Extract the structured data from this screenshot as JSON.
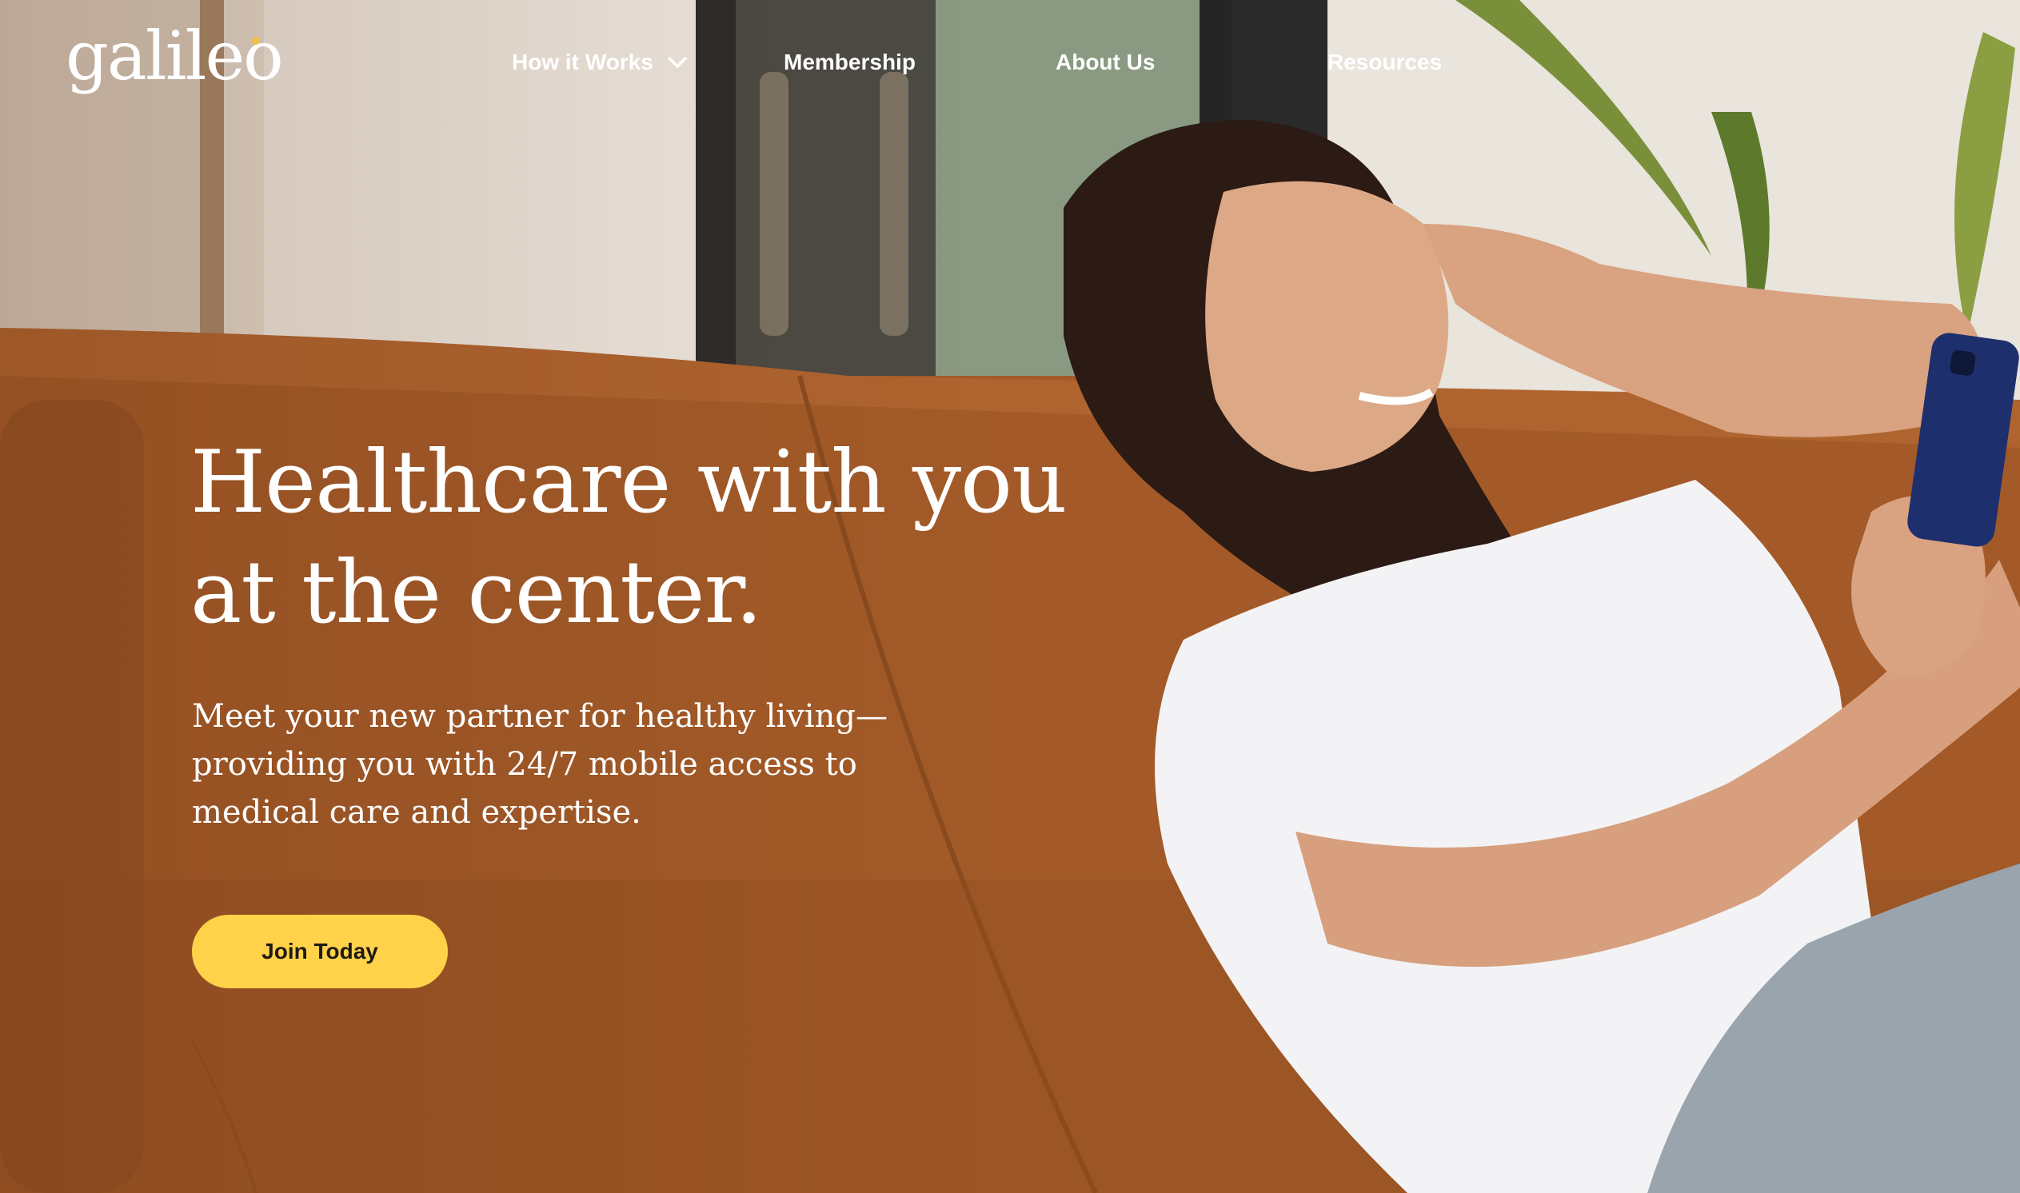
{
  "brand": {
    "logo_text": "galileo",
    "accent_color": "#f2c14b"
  },
  "nav": {
    "items": [
      {
        "label": "How it Works",
        "has_dropdown": true,
        "icon": "chevron-down-icon"
      },
      {
        "label": "Membership"
      },
      {
        "label": "About Us"
      },
      {
        "label": "Resources"
      }
    ]
  },
  "hero": {
    "headline": "Healthcare with you at the center.",
    "subtext": "Meet your new partner for healthy living—providing you with 24/7 mobile access to medical care and expertise.",
    "cta_label": "Join Today",
    "cta_color": "#ffd24a",
    "image": "woman-on-sofa-with-phone",
    "colors": {
      "sofa": "#a35a28",
      "wall": "#e6e0d6",
      "shirt": "#f3f3f5",
      "pants": "#9aa4ac",
      "phone": "#1e2f6e"
    }
  }
}
